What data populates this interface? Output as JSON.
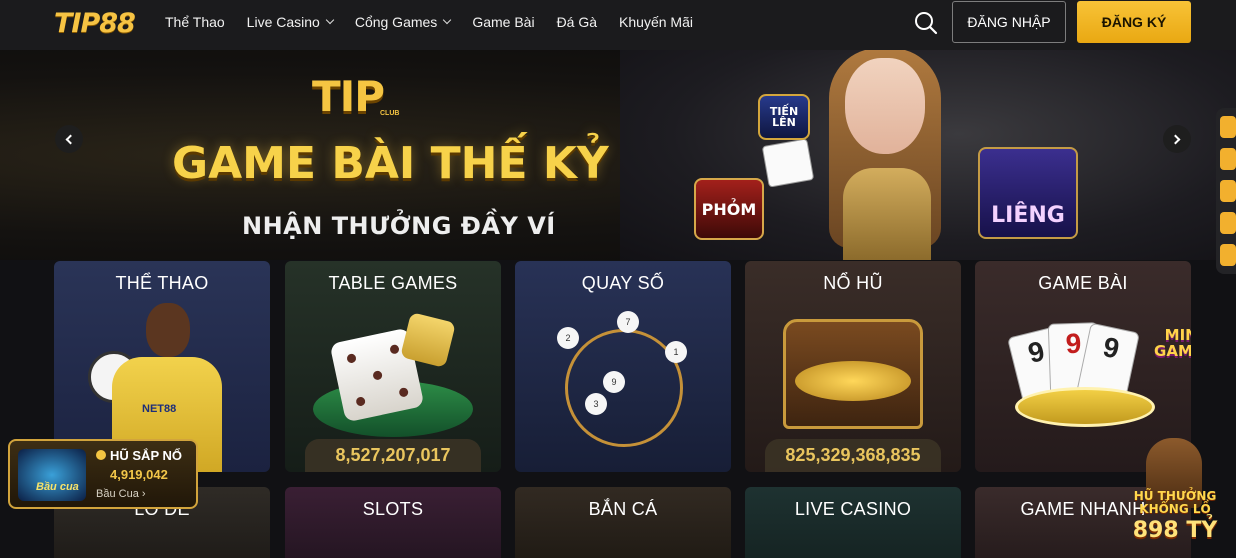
{
  "nav": {
    "logo": "TIP88",
    "links": [
      "Thể Thao",
      "Live Casino",
      "Cổng Games",
      "Game Bài",
      "Đá Gà",
      "Khuyến Mãi"
    ],
    "login_label": "ĐĂNG NHẬP",
    "register_label": "ĐĂNG KÝ",
    "icons": {
      "search": "search-icon",
      "dropdown": "chevron-down-icon"
    }
  },
  "banner": {
    "logo": "TIP",
    "logo_sub": "CLUB",
    "title": "GAME BÀI THẾ KỶ",
    "subtitle": "NHẬN THƯỞNG ĐẦY VÍ",
    "games": {
      "tienlen": "TIẾN LÊN",
      "phom": "PHỎM",
      "lieng": "LIÊNG"
    }
  },
  "categories": [
    {
      "title": "THỂ THAO",
      "value": null
    },
    {
      "title": "TABLE GAMES",
      "value": "8,527,207,017"
    },
    {
      "title": "QUAY SỐ",
      "value": null
    },
    {
      "title": "NỔ HŨ",
      "value": "825,329,368,835"
    },
    {
      "title": "GAME BÀI",
      "value": null,
      "badge": "MINI GAMES"
    }
  ],
  "categories_row2": [
    "LÔ ĐỀ",
    "SLOTS",
    "BẮN CÁ",
    "LIVE CASINO",
    "GAME NHANH"
  ],
  "sports_card": {
    "shirt_text": "NET88"
  },
  "jackpot": {
    "label": "HŨ SẮP NỔ",
    "value": "4,919,042",
    "game": "Bầu Cua",
    "thumb_text": "Bầu cua"
  },
  "promo": {
    "line1": "HŨ THƯỞNG",
    "line2": "KHỔNG LỒ",
    "amount": "898 TỶ"
  },
  "colors": {
    "accent": "#f5b82e",
    "nav_bg": "#1b1b1d",
    "value_text": "#e9c55e"
  }
}
